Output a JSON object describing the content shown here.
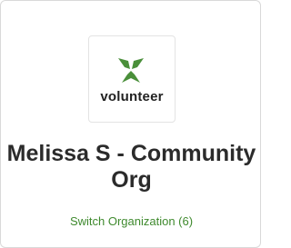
{
  "logo": {
    "icon": "volunteer-logo-icon",
    "wordmark": "volunteer",
    "brand_color": "#4a8f3a"
  },
  "organization": {
    "name": "Melissa S - Community Org"
  },
  "switch": {
    "label": "Switch Organization (6)",
    "color": "#3f8a2e"
  }
}
